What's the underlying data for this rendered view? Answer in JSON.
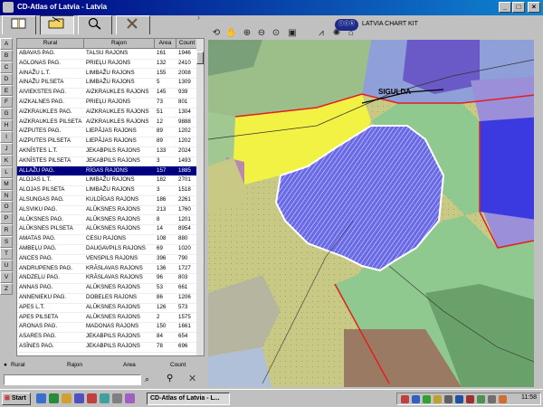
{
  "window": {
    "title": "CD-Atlas of Latvia - Latvia"
  },
  "toolbar": {
    "buttons": [
      "book-icon",
      "folder-icon",
      "search-icon",
      "tools-icon"
    ],
    "brand_text": "LATVIA CHART KIT"
  },
  "table": {
    "headers": [
      "Rural",
      "Rajon",
      "Area",
      "Count"
    ],
    "rows": [
      [
        "ABAVAS PAG.",
        "TALSU RAJONS",
        "161",
        "1946"
      ],
      [
        "AGLONAS PAG.",
        "PRIEĻU RAJONS",
        "132",
        "2410"
      ],
      [
        "AINAŽU L.T.",
        "LIMBAŽU RAJONS",
        "155",
        "2008"
      ],
      [
        "AINAŽU PILSETA",
        "LIMBAŽU RAJONS",
        "5",
        "1309"
      ],
      [
        "AIVIEKSTES PAG.",
        "AIZKRAUKLES RAJONS",
        "145",
        "939"
      ],
      [
        "AIZKALNES PAG.",
        "PRIEĻU RAJONS",
        "73",
        "801"
      ],
      [
        "AIZKRAUKLES PAG.",
        "AIZKRAUKLES RAJONS",
        "51",
        "1304"
      ],
      [
        "AIZKRAUKLES PILSETA",
        "AIZKRAUKLES RAJONS",
        "12",
        "9888"
      ],
      [
        "AIZPUTES PAG.",
        "LIEPĀJAS RAJONS",
        "89",
        "1202"
      ],
      [
        "AIZPUTES PILSETA",
        "LIEPĀJAS RAJONS",
        "89",
        "1202"
      ],
      [
        "AKNĪSTES L.T.",
        "JEKABPILS RAJONS",
        "133",
        "2024"
      ],
      [
        "AKNĪSTES PILSETA",
        "JEKABPILS RAJONS",
        "3",
        "1493"
      ],
      [
        "ALLAŽU PAG.",
        "RĪGAS RAJONS",
        "157",
        "1885"
      ],
      [
        "ALOJAS L.T.",
        "LIMBAŽU RAJONS",
        "182",
        "2701"
      ],
      [
        "ALOJAS PILSETA",
        "LIMBAŽU RAJONS",
        "3",
        "1518"
      ],
      [
        "ALSUNGAS PAG.",
        "KULDĪGAS RAJONS",
        "186",
        "2261"
      ],
      [
        "ALSVIKU PAG.",
        "ALŪKSNES RAJONS",
        "213",
        "1760"
      ],
      [
        "ALŪKSNES PAG.",
        "ALŪKSNES RAJONS",
        "8",
        "1201"
      ],
      [
        "ALŪKSNES PILSETA",
        "ALŪKSNES RAJONS",
        "14",
        "8954"
      ],
      [
        "AMATAS PAG.",
        "CESU RAJONS",
        "108",
        "880"
      ],
      [
        "AMBEĻU PAG.",
        "DAUGAVPILS RAJONS",
        "69",
        "1020"
      ],
      [
        "ANCES PAG.",
        "VENSPILS RAJONS",
        "396",
        "790"
      ],
      [
        "ANDRUPENES PAG.",
        "KRĀSLAVAS RAJONS",
        "136",
        "1727"
      ],
      [
        "ANDZEĻU PAG.",
        "KRĀSLAVAS RAJONS",
        "96",
        "803"
      ],
      [
        "ANNAS PAG.",
        "ALŪKSNES RAJONS",
        "53",
        "661"
      ],
      [
        "ANNENIEKU PAG.",
        "DOBELES RAJONS",
        "86",
        "1206"
      ],
      [
        "APES L.T.",
        "ALŪKSNES RAJONS",
        "126",
        "573"
      ],
      [
        "APES PILSETA",
        "ALŪKSNES RAJONS",
        "2",
        "1575"
      ],
      [
        "ARONAS PAG.",
        "MADONAS RAJONS",
        "150",
        "1661"
      ],
      [
        "ASARES PAG.",
        "JEKABPILS RAJONS",
        "84",
        "654"
      ],
      [
        "ASĪNES PAG.",
        "JEKABPILS RAJONS",
        "78",
        "696"
      ]
    ],
    "selected_index": 12
  },
  "letters": [
    "A",
    "B",
    "C",
    "D",
    "E",
    "F",
    "G",
    "H",
    "I",
    "J",
    "K",
    "L",
    "M",
    "N",
    "O",
    "P",
    "R",
    "S",
    "T",
    "U",
    "V",
    "Z"
  ],
  "search": {
    "options": [
      "Rural",
      "Rajon",
      "Area",
      "Count"
    ]
  },
  "map": {
    "place_label": "SIGULDA",
    "colors": {
      "yellow": "#f2f244",
      "khaki": "#c9c986",
      "green": "#8fc98f",
      "blue_hatch": "#5a5ae6",
      "purple": "#9a8fd8",
      "royal": "#3a3ae0",
      "brown": "#9b7a63",
      "magenta": "#b88ab0"
    }
  },
  "taskbar": {
    "start": "Start",
    "app": "CD-Atlas of Latvia - L...",
    "clock": "11:58"
  }
}
